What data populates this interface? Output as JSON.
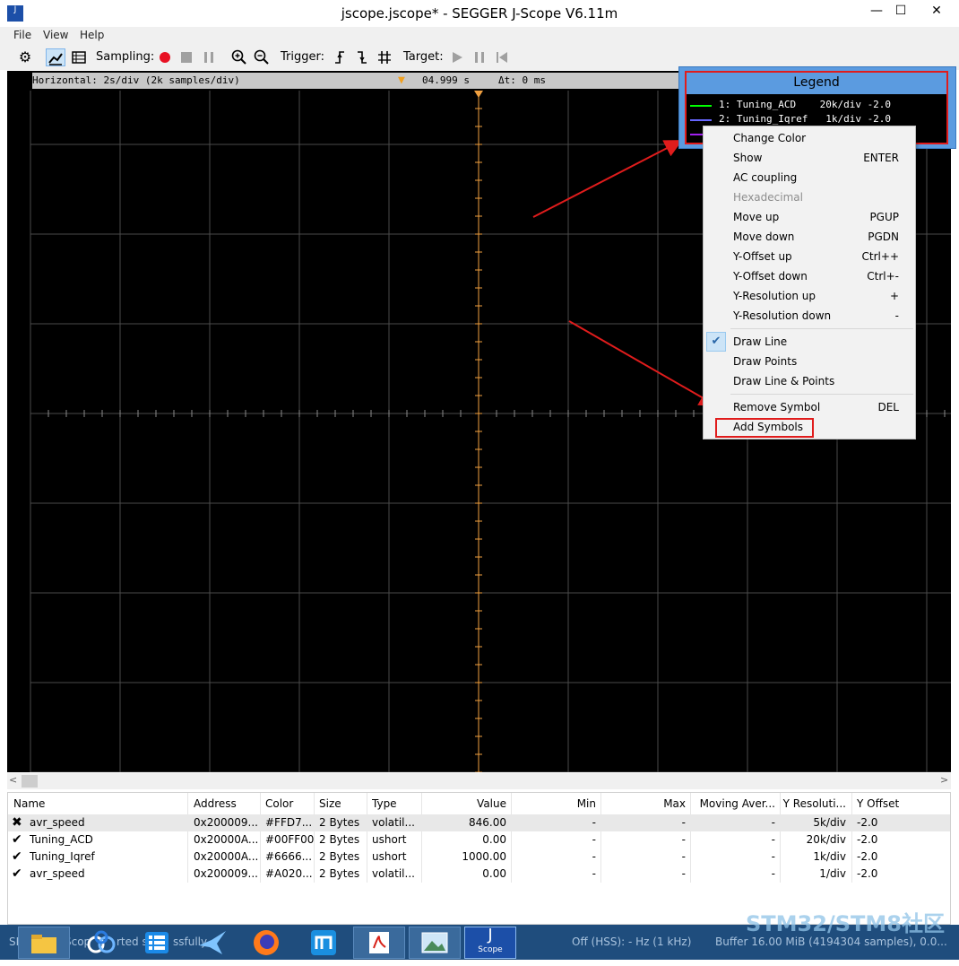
{
  "window": {
    "title": "jscope.jscope* - SEGGER J-Scope V6.11m",
    "app_icon_text": "J",
    "minimize": "—",
    "maximize": "☐",
    "close": "✕"
  },
  "menubar": {
    "items": [
      "File",
      "View",
      "Help"
    ]
  },
  "toolbar": {
    "sampling_label": "Sampling:",
    "trigger_label": "Trigger:",
    "target_label": "Target:",
    "icons": [
      "gear-icon",
      "line-view-icon",
      "table-view-icon",
      "record-icon",
      "stop-icon",
      "pause-icon",
      "zoom-in-icon",
      "zoom-out-icon",
      "rising-edge-icon",
      "falling-edge-icon",
      "both-edges-icon",
      "play-icon",
      "pause-target-icon",
      "reset-icon"
    ],
    "colors": {
      "record": "#e81123",
      "disabled": "#a0a0a0"
    }
  },
  "scope": {
    "horizontal_label": "Horizontal: 2s/div (2k samples/div)",
    "time_value": "04.999 s",
    "delta_label": "Δt: 0 ms",
    "colors": {
      "background": "#000000",
      "grid": "#4a4a4a",
      "trigger_line": "#f0a040"
    }
  },
  "legend": {
    "title": "Legend",
    "rows": [
      {
        "text": "1: Tuning_ACD    20k/div -2.0",
        "color": "#00ff00"
      },
      {
        "text": "2: Tuning_Iqref   1k/div -2.0",
        "color": "#6666ff"
      },
      {
        "text": "",
        "color": "#a020f0"
      }
    ]
  },
  "context_menu": {
    "items": [
      {
        "label": "Change Color",
        "shortcut": "",
        "disabled": false
      },
      {
        "label": "Show",
        "shortcut": "ENTER",
        "disabled": false
      },
      {
        "label": "AC coupling",
        "shortcut": "",
        "disabled": false
      },
      {
        "label": "Hexadecimal",
        "shortcut": "",
        "disabled": true
      },
      {
        "label": "Move up",
        "shortcut": "PGUP",
        "disabled": false
      },
      {
        "label": "Move down",
        "shortcut": "PGDN",
        "disabled": false
      },
      {
        "label": "Y-Offset up",
        "shortcut": "Ctrl++",
        "disabled": false
      },
      {
        "label": "Y-Offset down",
        "shortcut": "Ctrl+-",
        "disabled": false
      },
      {
        "label": "Y-Resolution up",
        "shortcut": "+",
        "disabled": false
      },
      {
        "label": "Y-Resolution down",
        "shortcut": "-",
        "disabled": false
      },
      {
        "label": "Draw Line",
        "shortcut": "",
        "disabled": false,
        "checked": true
      },
      {
        "label": "Draw Points",
        "shortcut": "",
        "disabled": false
      },
      {
        "label": "Draw Line & Points",
        "shortcut": "",
        "disabled": false
      },
      {
        "label": "Remove Symbol",
        "shortcut": "DEL",
        "disabled": false
      },
      {
        "label": "Add Symbols",
        "shortcut": "",
        "disabled": false
      }
    ]
  },
  "table": {
    "headers": [
      "Name",
      "Address",
      "Color",
      "Size",
      "Type",
      "Value",
      "Min",
      "Max",
      "Moving Aver...",
      "Y Resoluti...",
      "Y Offset"
    ],
    "rows": [
      {
        "status": "✖",
        "name": "avr_speed",
        "address": "0x200009...",
        "color": "#FFD7...",
        "size": "2 Bytes",
        "type": "volatil...",
        "value": "846.00",
        "min": "-",
        "max": "-",
        "avg": "-",
        "yres": "5k/div",
        "yoff": "-2.0"
      },
      {
        "status": "✔",
        "name": "Tuning_ACD",
        "address": "0x20000A...",
        "color": "#00FF00",
        "size": "2 Bytes",
        "type": "ushort",
        "value": "0.00",
        "min": "-",
        "max": "-",
        "avg": "-",
        "yres": "20k/div",
        "yoff": "-2.0"
      },
      {
        "status": "✔",
        "name": "Tuning_Iqref",
        "address": "0x20000A...",
        "color": "#6666...",
        "size": "2 Bytes",
        "type": "ushort",
        "value": "1000.00",
        "min": "-",
        "max": "-",
        "avg": "-",
        "yres": "1k/div",
        "yoff": "-2.0"
      },
      {
        "status": "✔",
        "name": "avr_speed",
        "address": "0x200009...",
        "color": "#A020...",
        "size": "2 Bytes",
        "type": "volatil...",
        "value": "0.00",
        "min": "-",
        "max": "-",
        "avg": "-",
        "yres": "1/div",
        "yoff": "-2.0"
      }
    ]
  },
  "taskbar": {
    "status_left": "SEG",
    "status_mid_1": "Scop",
    "status_mid_2": "rted s",
    "status_mid_3": "ssfully.",
    "status_right_1": "Off (HSS): - Hz (1 kHz)",
    "status_right_2": "Buffer 16.00 MiB (4194304 samples), 0.0...",
    "apps": [
      "file-explorer-icon",
      "baidu-netdisk-icon",
      "app-grid-icon",
      "bird-app-icon",
      "firefox-icon",
      "maxthon-icon",
      "pdf-reader-icon",
      "image-viewer-icon",
      "jscope-icon"
    ],
    "jscope_label": "Scope"
  },
  "watermark": "STM32/STM8社区"
}
